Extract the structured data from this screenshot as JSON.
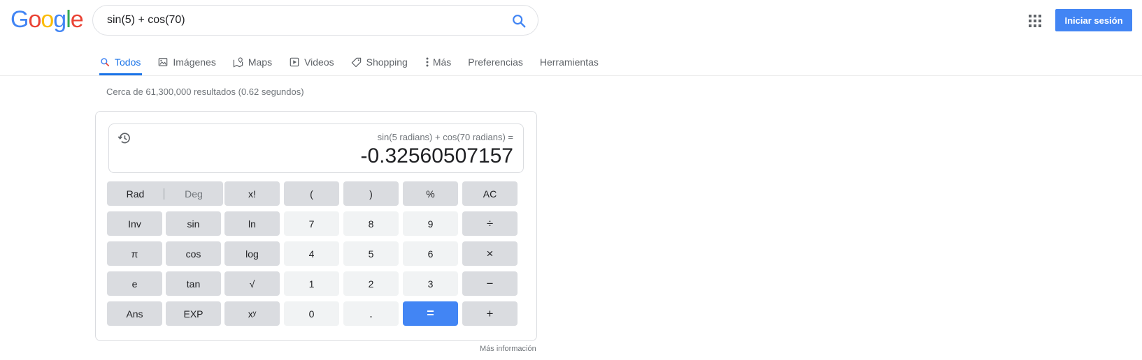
{
  "logo": {
    "letters": [
      "G",
      "o",
      "o",
      "g",
      "l",
      "e"
    ],
    "colors": [
      "#4285f4",
      "#ea4335",
      "#fbbc05",
      "#4285f4",
      "#34a853",
      "#ea4335"
    ]
  },
  "search": {
    "query": "sin(5) + cos(70)"
  },
  "header": {
    "signin_label": "Iniciar sesión"
  },
  "tabs": [
    {
      "label": "Todos",
      "icon": "search-icon",
      "active": true
    },
    {
      "label": "Imágenes",
      "icon": "image-icon"
    },
    {
      "label": "Maps",
      "icon": "map-icon"
    },
    {
      "label": "Videos",
      "icon": "video-icon"
    },
    {
      "label": "Shopping",
      "icon": "tag-icon"
    },
    {
      "label": "Más",
      "icon": "more-vert-icon"
    },
    {
      "label": "Preferencias"
    },
    {
      "label": "Herramientas"
    }
  ],
  "stats": "Cerca de 61,300,000 resultados (0.62 segundos)",
  "calculator": {
    "expression": "sin(5 radians) + cos(70 radians) =",
    "result": "-0.32560507157",
    "mode": {
      "rad": "Rad",
      "deg": "Deg",
      "selected": "Rad"
    },
    "rows": [
      [
        "x!",
        "(",
        ")",
        "%",
        "AC"
      ],
      [
        "Inv",
        "sin",
        "ln",
        "7",
        "8",
        "9",
        "÷"
      ],
      [
        "π",
        "cos",
        "log",
        "4",
        "5",
        "6",
        "×"
      ],
      [
        "e",
        "tan",
        "√",
        "1",
        "2",
        "3",
        "−"
      ],
      [
        "Ans",
        "EXP",
        "xʸ",
        "0",
        ".",
        "=",
        "+"
      ]
    ]
  },
  "more_info": "Más información",
  "colors": {
    "accent": "#1a73e8",
    "primary_button": "#4285f4"
  }
}
